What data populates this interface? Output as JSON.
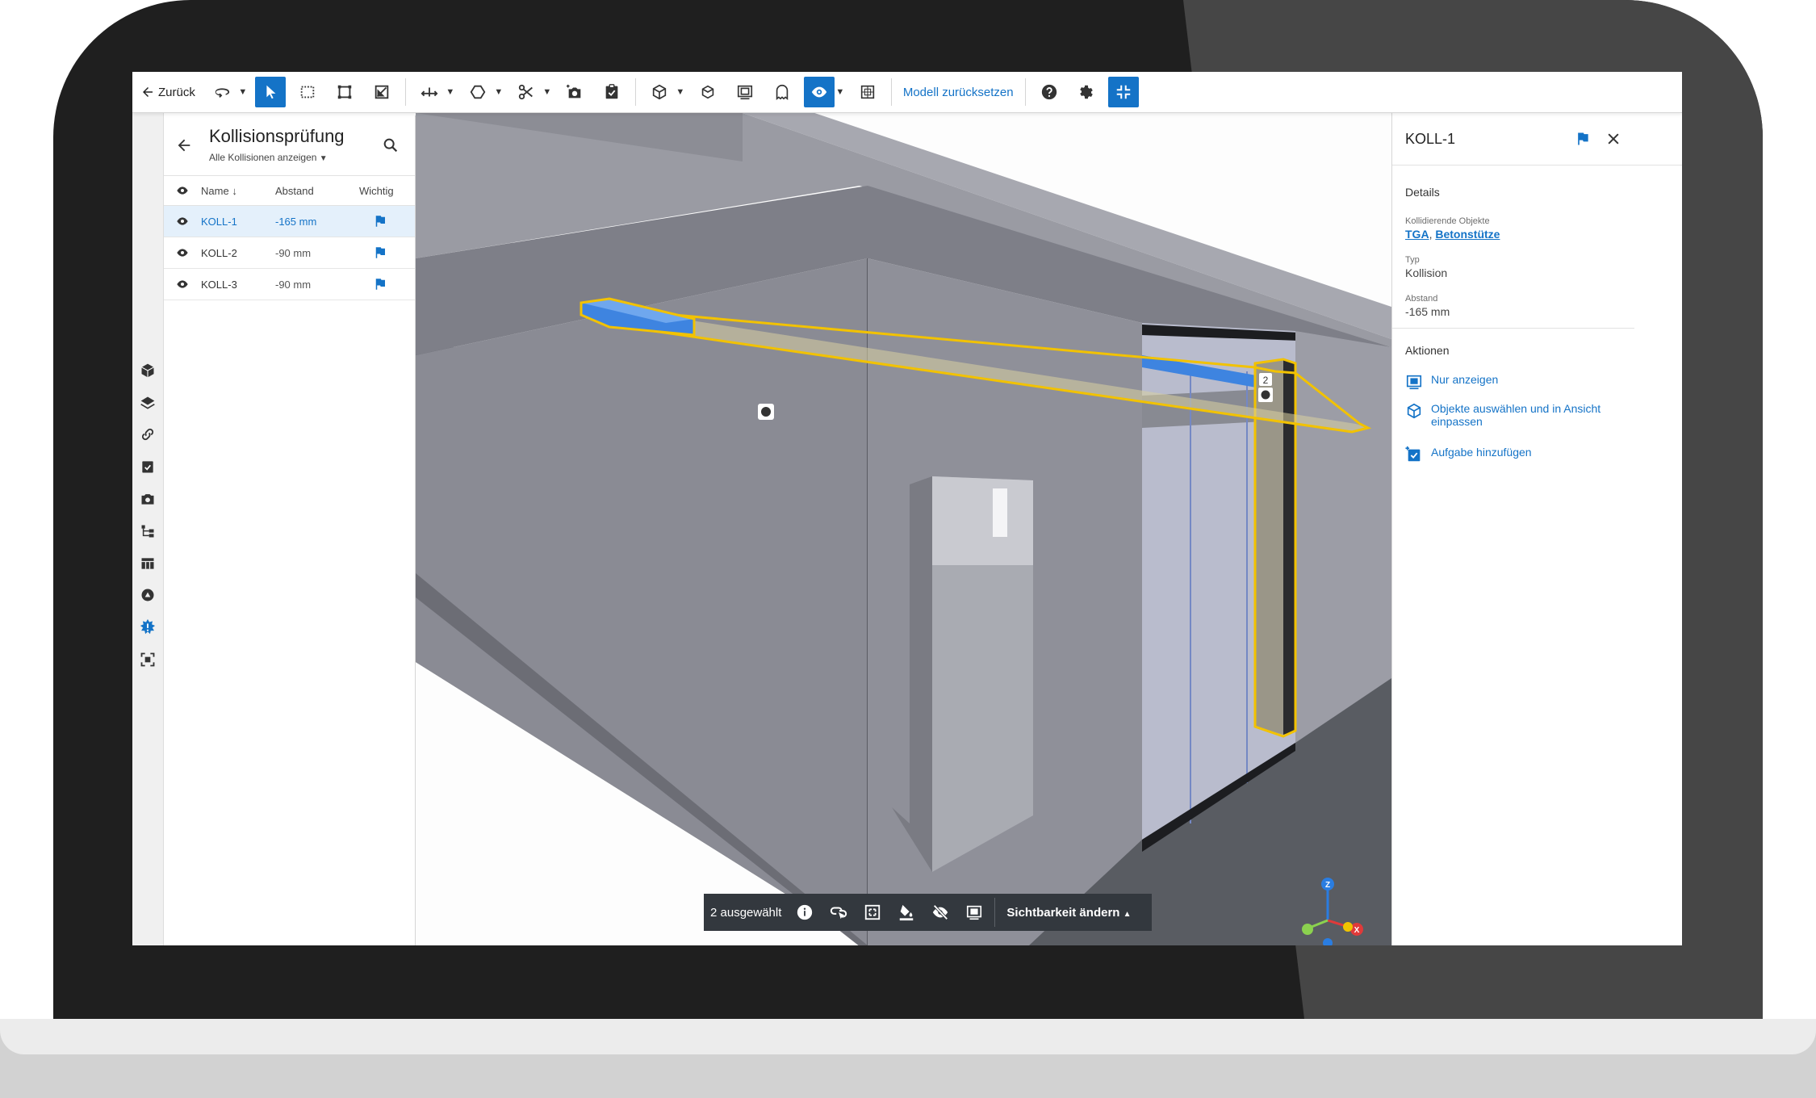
{
  "toolbar": {
    "back_label": "Zurück",
    "reset_model_label": "Modell zurücksetzen"
  },
  "left_panel": {
    "title": "Kollisionsprüfung",
    "filter_label": "Alle Kollisionen anzeigen",
    "columns": {
      "name": "Name",
      "distance": "Abstand",
      "important": "Wichtig"
    },
    "rows": [
      {
        "name": "KOLL-1",
        "distance": "-165 mm"
      },
      {
        "name": "KOLL-2",
        "distance": "-90 mm"
      },
      {
        "name": "KOLL-3",
        "distance": "-90 mm"
      }
    ]
  },
  "viewport": {
    "marker_label": "2",
    "axes": {
      "z": "Z",
      "x": "X"
    }
  },
  "selection_bar": {
    "count_label": "2 ausgewählt",
    "visibility_label": "Sichtbarkeit ändern"
  },
  "right_panel": {
    "title": "KOLL-1",
    "details_heading": "Details",
    "colliding_label": "Kollidierende Objekte",
    "colliding_objects": [
      "TGA",
      "Betonstütze"
    ],
    "colliding_sep": ", ",
    "type_label": "Typ",
    "type_value": "Kollision",
    "distance_label": "Abstand",
    "distance_value": "-165 mm",
    "actions_heading": "Aktionen",
    "actions": [
      {
        "label": "Nur anzeigen",
        "icon": "isolate-icon"
      },
      {
        "label": "Objekte auswählen und in Ansicht einpassen",
        "icon": "cube-fit-icon"
      },
      {
        "label": "Aufgabe hinzufügen",
        "icon": "task-add-icon"
      }
    ]
  },
  "colors": {
    "accent": "#1473c7",
    "highlight": "#f2c200",
    "frame_dark": "#1f1f1f",
    "toolbar_bar": "#33383e"
  }
}
